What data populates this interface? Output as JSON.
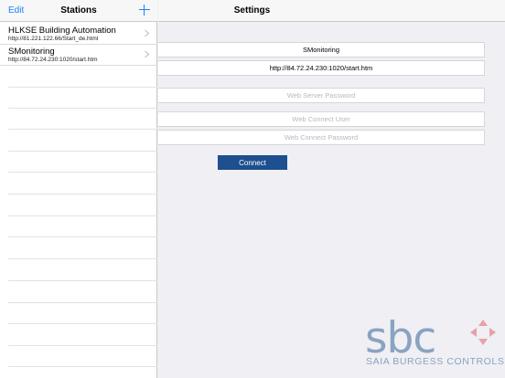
{
  "master": {
    "edit_label": "Edit",
    "title": "Stations",
    "stations": [
      {
        "name": "HLKSE Building Automation",
        "url": "http://81.221.122.66/Start_de.html"
      },
      {
        "name": "SMonitoring",
        "url": "http://84.72.24.230:1020/start.htm"
      }
    ]
  },
  "settings": {
    "title": "Settings",
    "station_name": "SMonitoring",
    "station_url": "http://84.72.24.230:1020/start.htm",
    "web_server_password_placeholder": "Web Server Password",
    "web_connect_user_placeholder": "Web Connect User",
    "web_connect_password_placeholder": "Web Connect Password",
    "connect_label": "Connect"
  },
  "logo": {
    "text": "sbc",
    "subtitle": "SAIA BURGESS CONTROLS"
  },
  "colors": {
    "accent": "#1a82fb",
    "button": "#1e4f8e",
    "logo_blue": "#8aa3c2",
    "logo_red": "#e8a0a8"
  }
}
